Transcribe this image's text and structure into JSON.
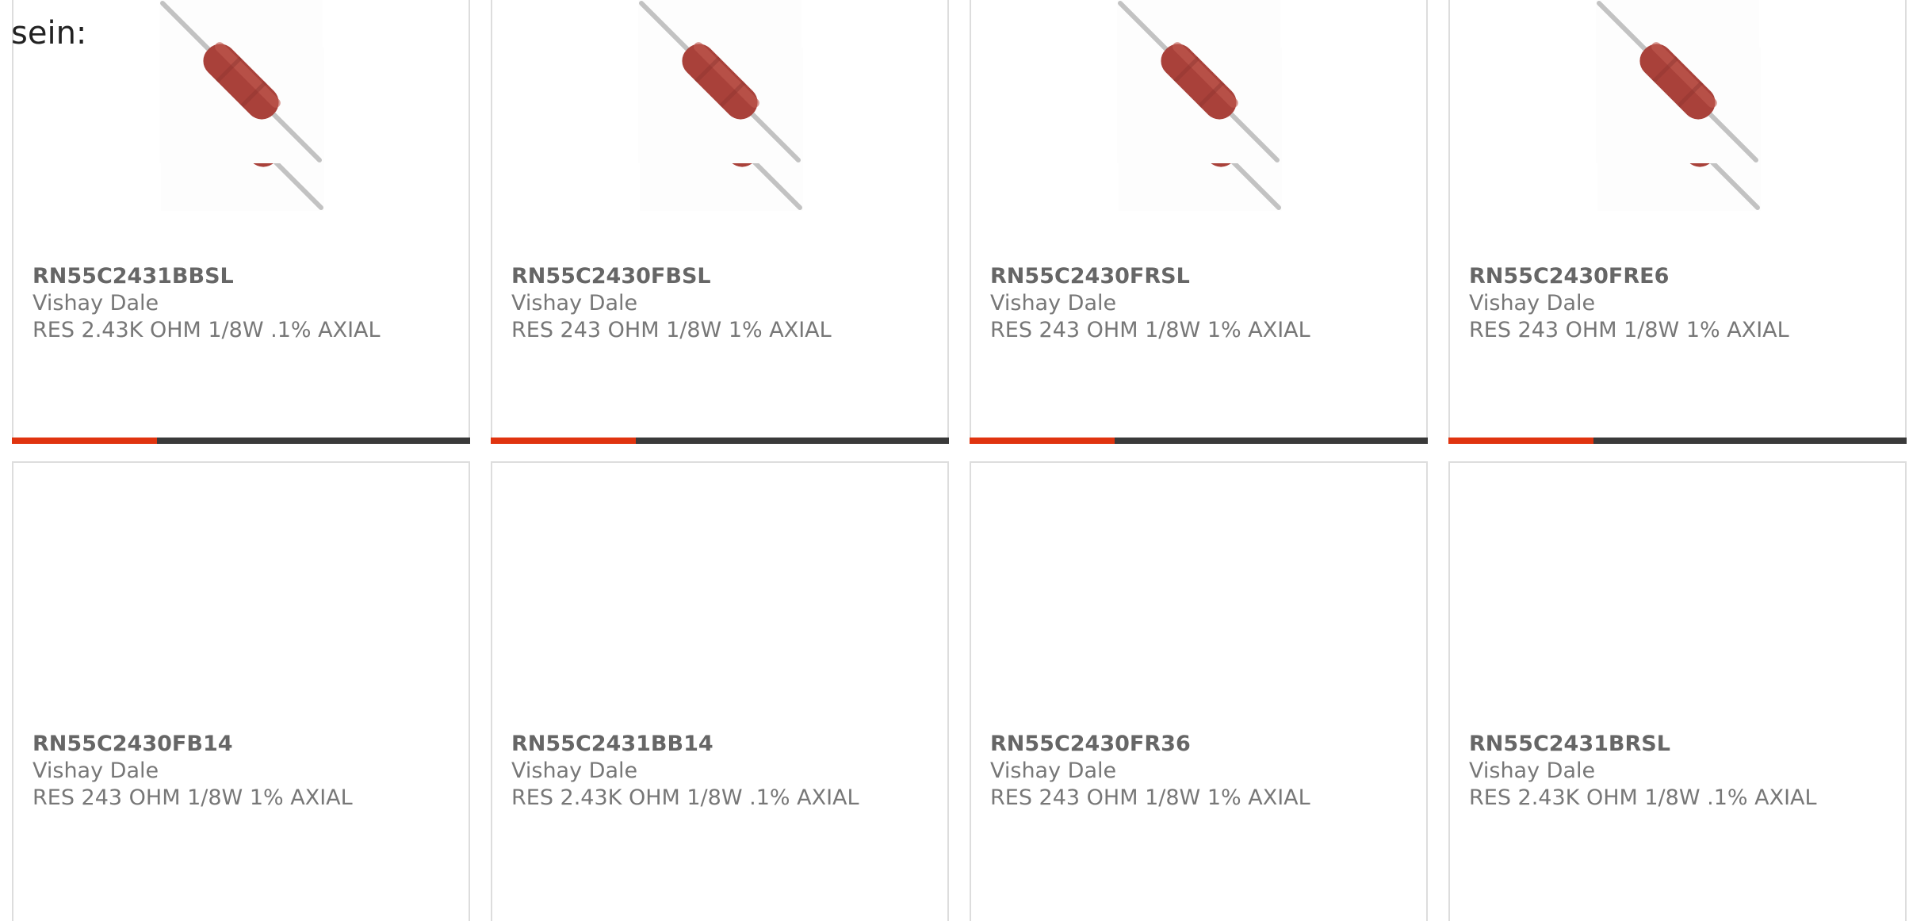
{
  "intro": {
    "text": "sein:"
  },
  "products": [
    {
      "part_number": "RN55C2431BBSL",
      "manufacturer": "Vishay Dale",
      "description": "RES 2.43K OHM 1/8W .1% AXIAL"
    },
    {
      "part_number": "RN55C2430FBSL",
      "manufacturer": "Vishay Dale",
      "description": "RES 243 OHM 1/8W 1% AXIAL"
    },
    {
      "part_number": "RN55C2430FRSL",
      "manufacturer": "Vishay Dale",
      "description": "RES 243 OHM 1/8W 1% AXIAL"
    },
    {
      "part_number": "RN55C2430FRE6",
      "manufacturer": "Vishay Dale",
      "description": "RES 243 OHM 1/8W 1% AXIAL"
    },
    {
      "part_number": "RN55C2430FB14",
      "manufacturer": "Vishay Dale",
      "description": "RES 243 OHM 1/8W 1% AXIAL"
    },
    {
      "part_number": "RN55C2431BB14",
      "manufacturer": "Vishay Dale",
      "description": "RES 2.43K OHM 1/8W .1% AXIAL"
    },
    {
      "part_number": "RN55C2430FR36",
      "manufacturer": "Vishay Dale",
      "description": "RES 243 OHM 1/8W 1% AXIAL"
    },
    {
      "part_number": "RN55C2431BRSL",
      "manufacturer": "Vishay Dale",
      "description": "RES 2.43K OHM 1/8W .1% AXIAL"
    }
  ],
  "colors": {
    "accent": "#e0340f",
    "bar_dark": "#3a3a3a",
    "resistor_body": "#a9413a",
    "lead_wire": "#b8b8b8",
    "part_text": "#666666",
    "body_text": "#777777"
  },
  "icons": {
    "product_image": "axial-resistor-image"
  }
}
